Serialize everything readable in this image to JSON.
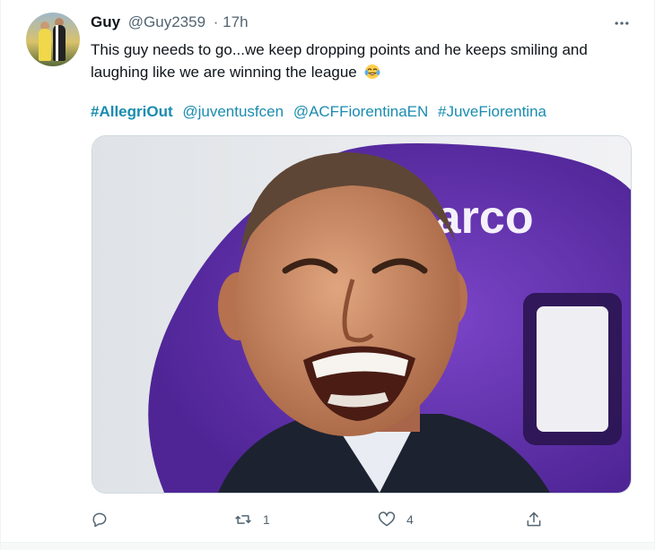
{
  "tweet": {
    "author_name": "Guy",
    "author_handle": "@Guy2359",
    "time": "· 17h",
    "text_line1": "This guy needs to go...we keep dropping points and he keeps smiling and",
    "text_line2": "laughing like we are winning the league",
    "hashtags": [
      "#AllegriOut",
      "@juventusfcen",
      "@ACFFiorentinaEN",
      "#JuveFiorentina"
    ],
    "media_sign_text": "parco"
  },
  "actions": {
    "reply_count": "",
    "retweet_count": "1",
    "like_count": "4"
  },
  "icons": {
    "more": "more-horizontal-icon",
    "reply": "reply-icon",
    "retweet": "retweet-icon",
    "like": "heart-icon",
    "share": "share-icon",
    "emoji": "tears-of-joy-emoji"
  },
  "colors": {
    "link": "#1a8cb0",
    "secondary_text": "#536471",
    "primary_text": "#0f1419"
  }
}
